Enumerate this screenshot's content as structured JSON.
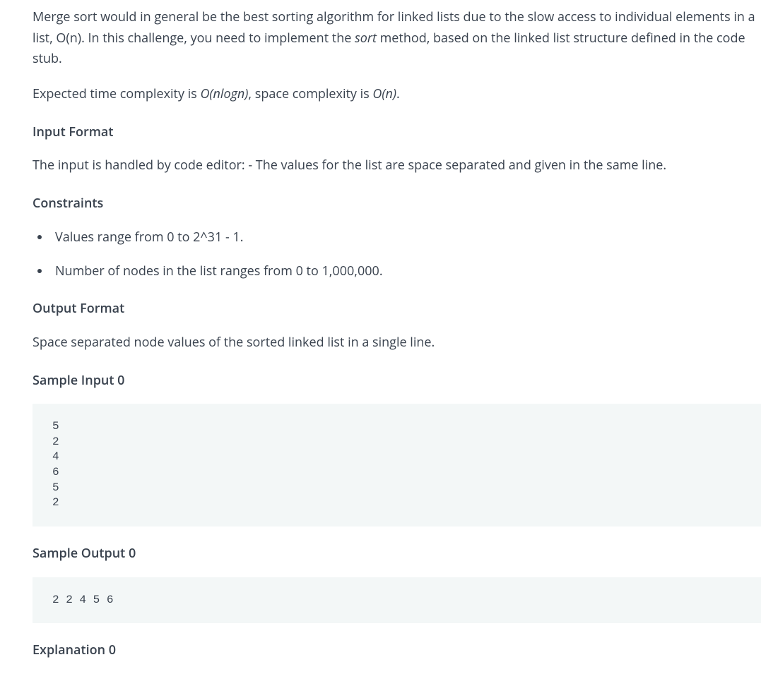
{
  "intro": {
    "p1_pre": "Merge sort would in general be the best sorting algorithm for linked lists due to the slow access to individual elements in a list, O(n). In this challenge, you need to implement the ",
    "p1_em": "sort",
    "p1_post": " method, based on the linked list structure defined in the code stub.",
    "p2_a": "Expected time complexity is ",
    "p2_em1": "O(nlogn)",
    "p2_b": ", space complexity is ",
    "p2_em2": "O(n)",
    "p2_c": "."
  },
  "headings": {
    "input_format": "Input Format",
    "constraints": "Constraints",
    "output_format": "Output Format",
    "sample_input_0": "Sample Input 0",
    "sample_output_0": "Sample Output 0",
    "explanation_0": "Explanation 0"
  },
  "input_format_text": "The input is handled by code editor: - The values for the list are space separated and given in the same line.",
  "constraints": {
    "c1": "Values range from 0 to 2^31 - 1.",
    "c2": "Number of nodes in the list ranges from 0 to 1,000,000."
  },
  "output_format_text": "Space separated node values of the sorted linked list in a single line.",
  "sample_input_0": "5\n2\n4\n6\n5\n2",
  "sample_output_0": "2 2 4 5 6"
}
